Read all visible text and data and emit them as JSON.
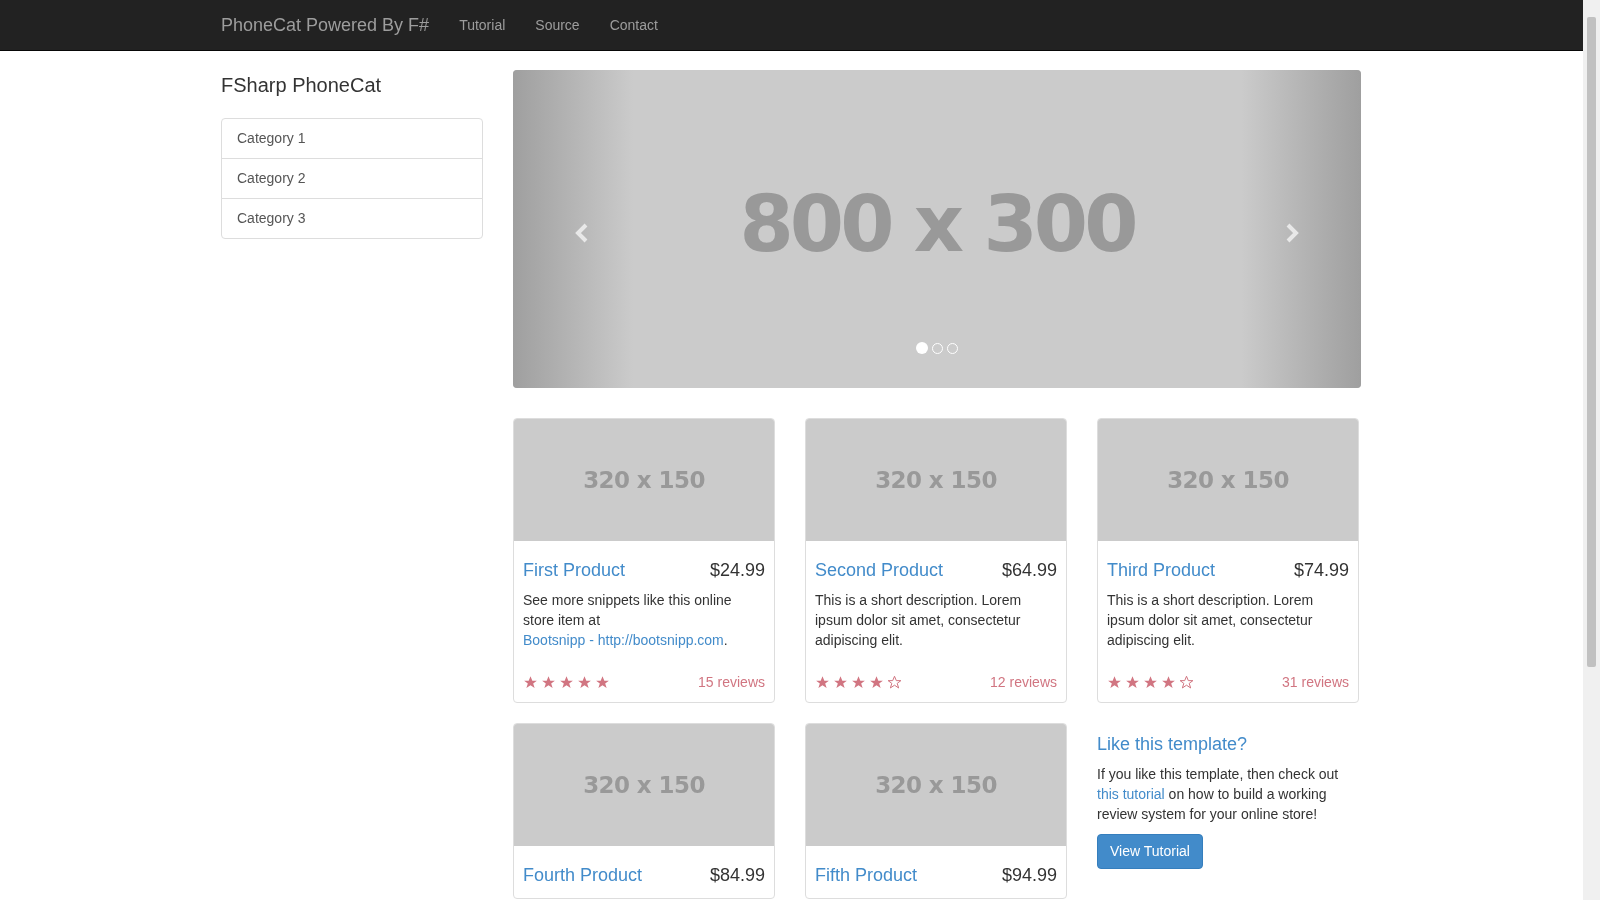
{
  "navbar": {
    "brand": "PhoneCat Powered By F#",
    "links": [
      {
        "label": "Tutorial"
      },
      {
        "label": "Source"
      },
      {
        "label": "Contact"
      }
    ]
  },
  "sidebar": {
    "title": "FSharp PhoneCat",
    "categories": [
      {
        "label": "Category 1"
      },
      {
        "label": "Category 2"
      },
      {
        "label": "Category 3"
      }
    ]
  },
  "carousel": {
    "label": "800 x 300",
    "slides": [
      {
        "selected": true
      },
      {
        "selected": false
      },
      {
        "selected": false
      }
    ]
  },
  "products": [
    {
      "image_label": "320 x 150",
      "name": "First Product",
      "price": "$24.99",
      "description": [
        {
          "kind": "text",
          "text": "See more snippets like this online store item at "
        },
        {
          "kind": "link",
          "text": "Bootsnipp - http://bootsnipp.com"
        },
        {
          "kind": "text",
          "text": "."
        }
      ],
      "stars": 5,
      "reviews": "15 reviews"
    },
    {
      "image_label": "320 x 150",
      "name": "Second Product",
      "price": "$64.99",
      "description": [
        {
          "kind": "text",
          "text": "This is a short description. Lorem ipsum dolor sit amet, consectetur adipiscing elit."
        }
      ],
      "stars": 4,
      "reviews": "12 reviews"
    },
    {
      "image_label": "320 x 150",
      "name": "Third Product",
      "price": "$74.99",
      "description": [
        {
          "kind": "text",
          "text": "This is a short description. Lorem ipsum dolor sit amet, consectetur adipiscing elit."
        }
      ],
      "stars": 4,
      "reviews": "31 reviews"
    },
    {
      "image_label": "320 x 150",
      "name": "Fourth Product",
      "price": "$84.99"
    },
    {
      "image_label": "320 x 150",
      "name": "Fifth Product",
      "price": "$94.99"
    }
  ],
  "promo": {
    "title": "Like this template?",
    "text": [
      {
        "kind": "text",
        "text": "If you like this template, then check out "
      },
      {
        "kind": "link",
        "text": "this tutorial"
      },
      {
        "kind": "text",
        "text": " on how to build a working review system for your online store!"
      }
    ],
    "button": "View Tutorial"
  }
}
